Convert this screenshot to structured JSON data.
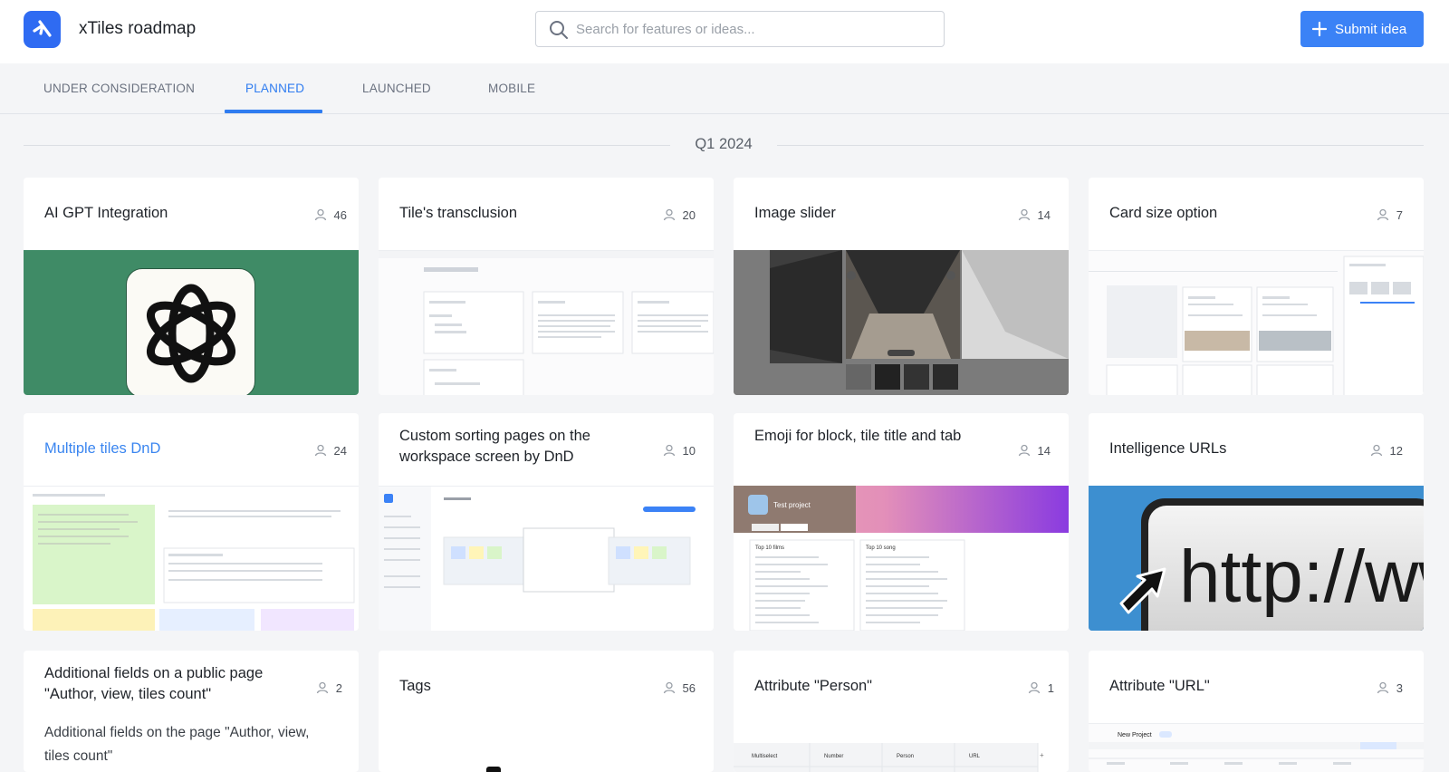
{
  "header": {
    "app_title": "xTiles roadmap",
    "search_placeholder": "Search for features or ideas...",
    "submit_label": "Submit idea",
    "accent_color": "#3b82f6"
  },
  "tabs": [
    {
      "label": "UNDER CONSIDERATION",
      "active": false
    },
    {
      "label": "PLANNED",
      "active": true
    },
    {
      "label": "LAUNCHED",
      "active": false
    },
    {
      "label": "MOBILE",
      "active": false
    }
  ],
  "section": {
    "label": "Q1 2024"
  },
  "cards": [
    {
      "title": "AI GPT Integration",
      "votes": "46",
      "image": "openai-logo"
    },
    {
      "title": "Tile's transclusion",
      "votes": "20",
      "image": "document-screenshot"
    },
    {
      "title": "Image slider",
      "votes": "14",
      "image": "gallery-screenshot"
    },
    {
      "title": "Card size option",
      "votes": "7",
      "image": "project-board-screenshot"
    },
    {
      "title": "Multiple tiles DnD",
      "votes": "24",
      "image": "tiles-screenshot"
    },
    {
      "title": "Custom sorting pages on the workspace screen by DnD",
      "votes": "10",
      "image": "workspace-screenshot"
    },
    {
      "title": "Emoji for block, tile title and tab",
      "votes": "14",
      "image": "emoji-project-screenshot",
      "preview_text": {
        "project": "Test project",
        "list_a": "Top 10 films",
        "list_b": "Top 10 song"
      }
    },
    {
      "title": "Intelligence URLs",
      "votes": "12",
      "image": "http-url-graphic",
      "preview_text": {
        "url": "http://www"
      }
    },
    {
      "title": "Additional fields on a public page \"Author, view, tiles count\"",
      "votes": "2",
      "description": "Additional fields on the page \"Author, view, tiles count\""
    },
    {
      "title": "Tags",
      "votes": "56"
    },
    {
      "title": "Attribute \"Person\"",
      "votes": "1",
      "image": "table-screenshot",
      "preview_text": {
        "col1": "Multiselect",
        "col2": "Number",
        "col3": "Person",
        "col4": "URL"
      }
    },
    {
      "title": "Attribute \"URL\"",
      "votes": "3",
      "image": "project-screenshot",
      "preview_text": {
        "project": "New Project"
      }
    }
  ]
}
